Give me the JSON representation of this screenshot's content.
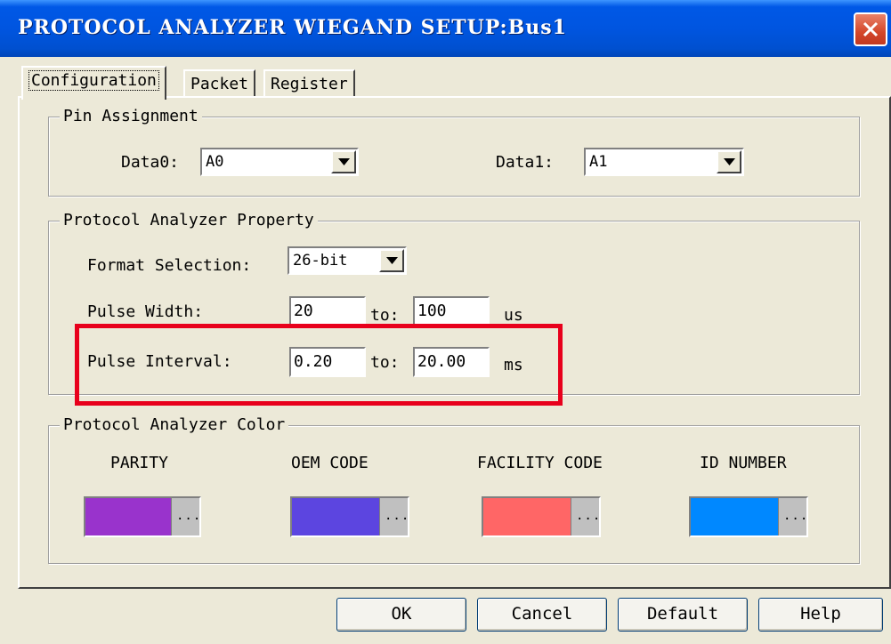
{
  "window": {
    "title": "PROTOCOL ANALYZER WIEGAND SETUP:Bus1"
  },
  "tabs": [
    {
      "label": "Configuration",
      "active": true
    },
    {
      "label": "Packet",
      "active": false
    },
    {
      "label": "Register",
      "active": false
    }
  ],
  "pin_assignment": {
    "legend": "Pin Assignment",
    "data0": {
      "label": "Data0:",
      "value": "A0"
    },
    "data1": {
      "label": "Data1:",
      "value": "A1"
    }
  },
  "property": {
    "legend": "Protocol Analyzer Property",
    "format": {
      "label": "Format Selection:",
      "value": "26-bit"
    },
    "pulse_width": {
      "label": "Pulse Width:",
      "from": "20",
      "to_label": "to:",
      "to": "100",
      "unit": "us"
    },
    "pulse_interval": {
      "label": "Pulse Interval:",
      "from": "0.20",
      "to_label": "to:",
      "to": "20.00",
      "unit": "ms"
    }
  },
  "color": {
    "legend": "Protocol Analyzer Color",
    "items": [
      {
        "label": "PARITY",
        "color": "#9933cc"
      },
      {
        "label": "OEM CODE",
        "color": "#5c45e0"
      },
      {
        "label": "FACILITY CODE",
        "color": "#ff6666"
      },
      {
        "label": "ID NUMBER",
        "color": "#0088ff"
      }
    ],
    "button_text": "..."
  },
  "buttons": {
    "ok": "OK",
    "cancel": "Cancel",
    "default": "Default",
    "help": "Help"
  },
  "highlight_color": "#e8001c"
}
